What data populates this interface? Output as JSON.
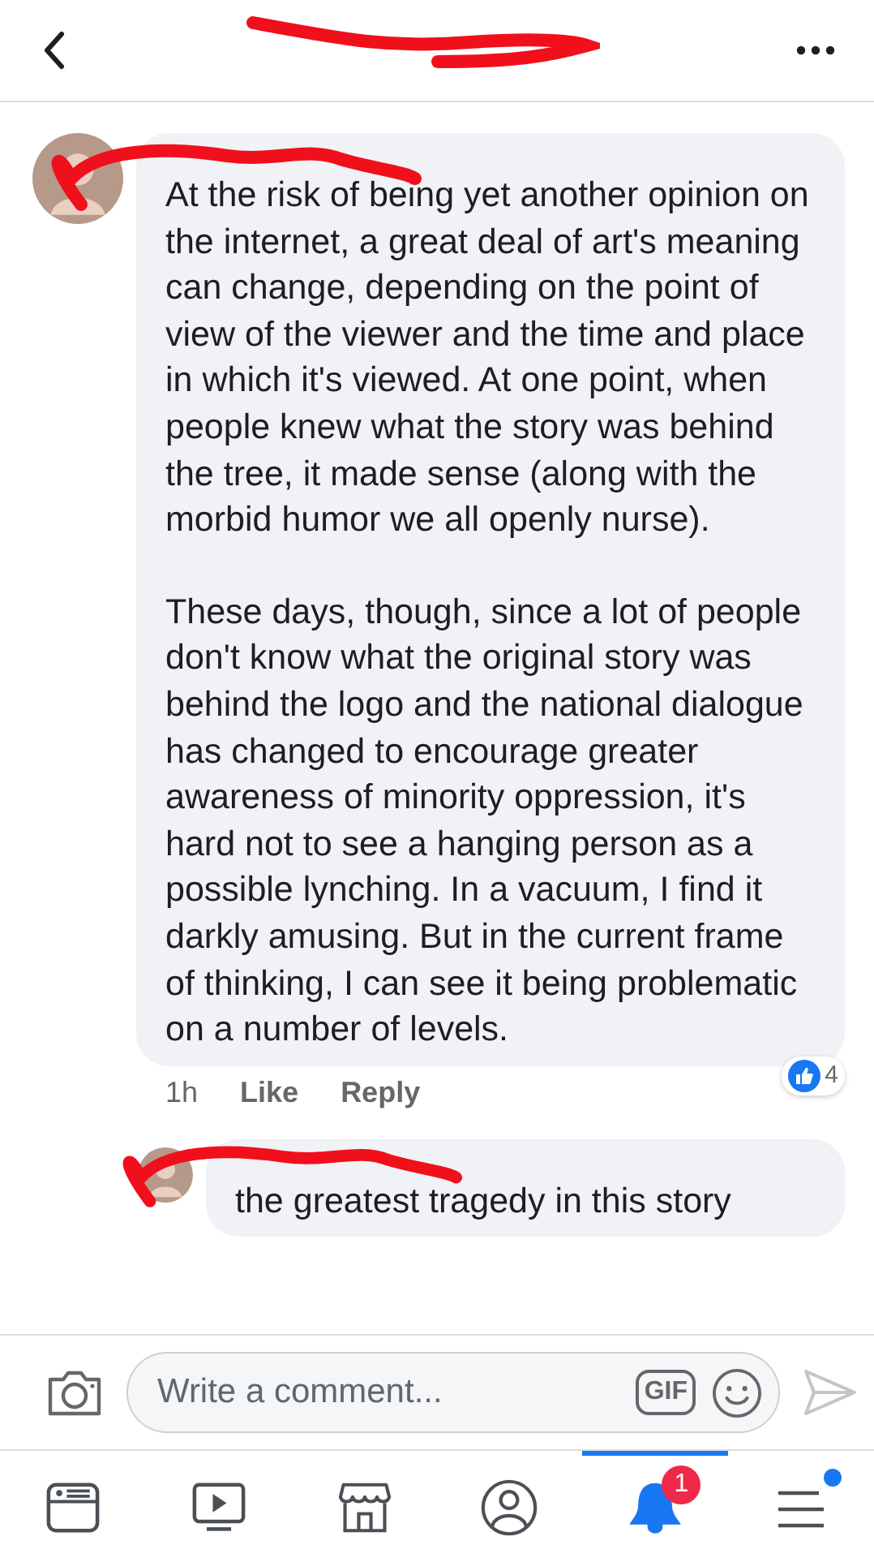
{
  "comments": [
    {
      "paragraphs": [
        "At the risk of being yet another opinion on the internet, a great deal of art's meaning can change, depending on the point of view of the viewer and the time and place in which it's viewed. At one point, when people knew what the story was behind the tree, it made sense (along with the morbid humor we all openly nurse).",
        "These days, though, since a lot of people don't know what the original story was behind the logo and the national dialogue has changed to encourage greater awareness of minority oppression, it's hard not to see a hanging person as a possible lynching. In a vacuum, I find it darkly amusing. But in the current frame of thinking, I can see it being problematic on a number of levels."
      ],
      "time": "1h",
      "like": "Like",
      "reply": "Reply",
      "reactions": "4",
      "reply_level": false
    },
    {
      "paragraphs": [
        "the greatest tragedy in this story"
      ],
      "reply_level": true
    }
  ],
  "composer": {
    "placeholder": "Write a comment...",
    "gif": "GIF"
  },
  "tabs": [
    {
      "kind": "feed",
      "selected": false
    },
    {
      "kind": "watch",
      "selected": false
    },
    {
      "kind": "marketplace",
      "selected": false
    },
    {
      "kind": "profile",
      "selected": false
    },
    {
      "kind": "notifications",
      "selected": true,
      "badge": "1"
    },
    {
      "kind": "menu",
      "selected": false,
      "has_new": true
    }
  ]
}
